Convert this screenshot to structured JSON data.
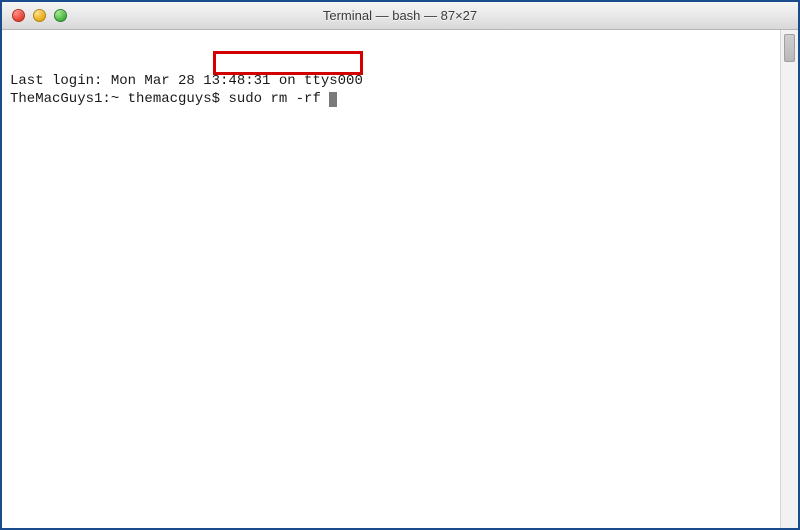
{
  "window": {
    "title": "Terminal — bash — 87×27"
  },
  "traffic_lights": {
    "close_color": "#e33e32",
    "minimize_color": "#e6a817",
    "zoom_color": "#3fb13f"
  },
  "terminal": {
    "last_login_line": "Last login: Mon Mar 28 13:48:31 on ttys000",
    "prompt_prefix": "TheMacGuys1:~ themacguys$ ",
    "command_text": "sudo rm -rf "
  },
  "highlight": {
    "border_color": "#d30000"
  }
}
